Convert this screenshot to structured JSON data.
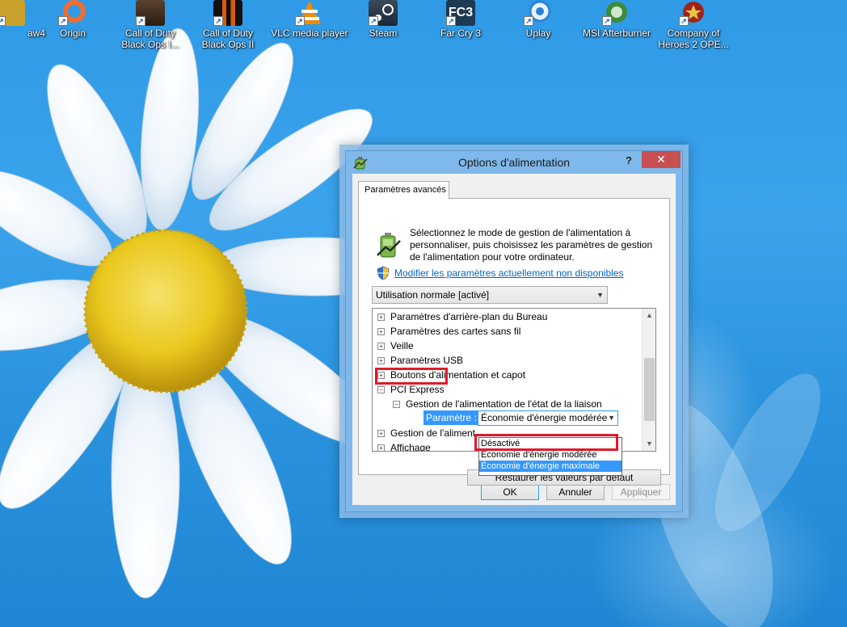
{
  "desktop": {
    "icons": [
      {
        "label": "aw4",
        "icon": "game-icon",
        "color": "#c9a22d",
        "x_label_align": "left"
      },
      {
        "label": "Origin",
        "icon": "origin-icon",
        "color": "#f56c2d"
      },
      {
        "label": "Call of Duty Black Ops I...",
        "icon": "cod-icon",
        "color": "#3b2a1c"
      },
      {
        "label": "Call of Duty Black Ops II",
        "icon": "cod2-icon",
        "color": "#d85a12"
      },
      {
        "label": "VLC media player",
        "icon": "vlc-icon",
        "color": "#f08a00"
      },
      {
        "label": "Steam",
        "icon": "steam-icon",
        "color": "#1b2838"
      },
      {
        "label": "Far Cry 3",
        "icon": "farcry3-icon",
        "color": "#1d3a52"
      },
      {
        "label": "Uplay",
        "icon": "uplay-icon",
        "color": "#2a82d8"
      },
      {
        "label": "MSI Afterburner",
        "icon": "msi-icon",
        "color": "#3d8a3a"
      },
      {
        "label": "Company of Heroes 2  OPE...",
        "icon": "coh2-icon",
        "color": "#a0231b"
      }
    ]
  },
  "dialog": {
    "title": "Options d'alimentation",
    "help": "?",
    "close": "✕",
    "tab": "Paramètres avancés",
    "intro": "Sélectionnez le mode de gestion de l'alimentation à personnaliser, puis choisissez les paramètres de gestion de l'alimentation pour votre ordinateur.",
    "link": "Modifier les paramètres actuellement non disponibles",
    "plan": "Utilisation normale [activé]",
    "tree": {
      "items": [
        {
          "label": "Paramètres d'arrière-plan du Bureau",
          "expander": "+"
        },
        {
          "label": "Paramètres des cartes sans fil",
          "expander": "+"
        },
        {
          "label": "Veille",
          "expander": "+"
        },
        {
          "label": "Paramètres USB",
          "expander": "+"
        },
        {
          "label": "Boutons d'alimentation et capot",
          "expander": "+"
        },
        {
          "label": "PCI Express",
          "expander": "−"
        },
        {
          "label": "Gestion de l'alimentation de l'état de la liaison",
          "expander": "−"
        },
        {
          "label": "Gestion de l'aliment",
          "expander": "+"
        },
        {
          "label": "Affichage",
          "expander": "+"
        }
      ],
      "param_label": "Paramètre :",
      "param_value": "Économie d'énergie modérée"
    },
    "dropdown_options": [
      {
        "label": "Désactivé",
        "selected": false
      },
      {
        "label": "Économie d'énergie modérée",
        "selected": false
      },
      {
        "label": "Économie d'énergie maximale",
        "selected": true
      }
    ],
    "restore": "Restaurer les valeurs par défaut",
    "ok": "OK",
    "cancel": "Annuler",
    "apply": "Appliquer"
  },
  "colors": {
    "accent": "#3399ff",
    "highlight_box": "#e01a2b",
    "close_button": "#c75050",
    "link": "#0066cc"
  }
}
